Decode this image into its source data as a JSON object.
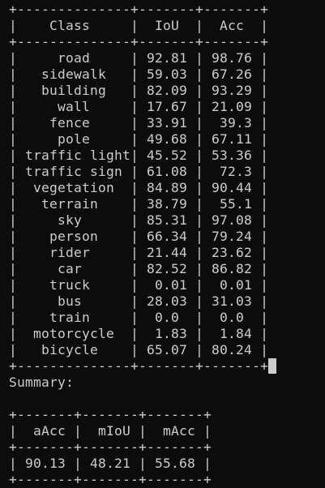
{
  "terminal": {
    "lines": [
      "+--------------+-------+-------+",
      "|    Class     |  IoU  |  Acc  |",
      "+--------------+-------+-------+",
      "|     road     | 92.81 | 98.76 |",
      "|   sidewalk   | 59.03 | 67.26 |",
      "|   building   | 82.09 | 93.29 |",
      "|     wall     | 17.67 | 21.09 |",
      "|    fence     | 33.91 |  39.3 |",
      "|     pole     | 49.68 | 67.11 |",
      "| traffic light| 45.52 | 53.36 |",
      "| traffic sign | 61.08 |  72.3 |",
      "|  vegetation  | 84.89 | 90.44 |",
      "|   terrain    | 38.79 |  55.1 |",
      "|     sky      | 85.31 | 97.08 |",
      "|    person    | 66.34 | 79.24 |",
      "|    rider     | 21.44 | 23.62 |",
      "|     car      | 82.52 | 86.82 |",
      "|    truck     |  0.01 |  0.01 |",
      "|     bus      | 28.03 | 31.03 |",
      "|    train     |  0.0  |  0.0  |",
      "|  motorcycle  |  1.83 |  1.84 |",
      "|   bicycle    | 65.07 | 80.24 |",
      "+--------------+-------+-------+",
      "Summary:",
      "",
      "+-------+-------+-------+",
      "|  aAcc |  mIoU |  mAcc |",
      "+-------+-------+-------+",
      "| 90.13 | 48.21 | 55.68 |",
      "+-------+-------+-------+"
    ]
  }
}
